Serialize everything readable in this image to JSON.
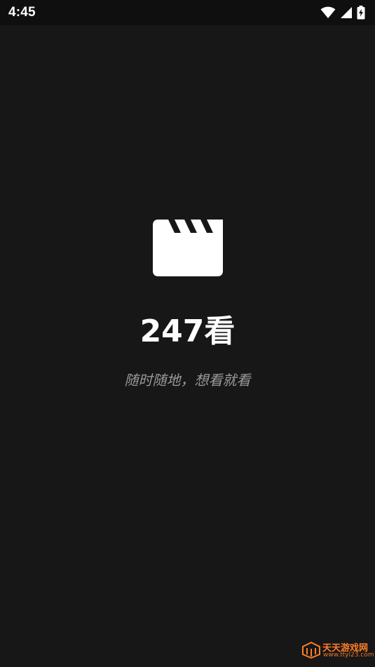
{
  "status_bar": {
    "time": "4:45",
    "icons": [
      "wifi-icon",
      "signal-icon",
      "battery-charging-icon"
    ]
  },
  "splash": {
    "logo_icon": "clapperboard-icon",
    "app_name": "247看",
    "tagline": "随时随地，想看就看"
  },
  "watermark": {
    "name": "天天游戏网",
    "url": "www.ttyl23.com"
  },
  "colors": {
    "background": "#171717",
    "status_bar": "#0f0f0f",
    "text": "#ffffff",
    "tagline": "#9a9a9a",
    "watermark": "#ff7f27"
  }
}
